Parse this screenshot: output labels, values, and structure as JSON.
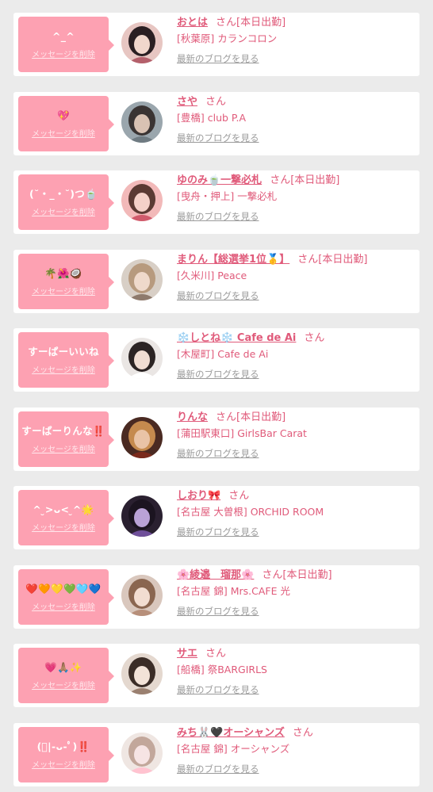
{
  "messages": [
    {
      "bubble_text": "^_^",
      "delete_label": "メッセージを削除",
      "name": "おとは",
      "honorific": "さん",
      "status": "[本日出勤]",
      "shop": "[秋葉原] カランコロン",
      "blog_link": "最新のブログを見る",
      "avatar_colors": [
        "#e7c6c2",
        "#2a1f22",
        "#f1d7cc",
        "#b4606b"
      ]
    },
    {
      "bubble_text": "💖",
      "delete_label": "メッセージを削除",
      "name": "さや",
      "honorific": "さん",
      "status": "",
      "shop": "[豊橋] club P.A",
      "blog_link": "最新のブログを見る",
      "avatar_colors": [
        "#9aa6ad",
        "#3a3433",
        "#d9c2b3",
        "#6f7b82"
      ]
    },
    {
      "bubble_text": "(˘・_・˘)つ🍵",
      "delete_label": "メッセージを削除",
      "name": "ゆのみ🍵一撃必札",
      "honorific": "さん",
      "status": "[本日出勤]",
      "shop": "[曳舟・押上] 一撃必札",
      "blog_link": "最新のブログを見る",
      "avatar_colors": [
        "#f2b9b9",
        "#5b3a33",
        "#f4d1c8",
        "#d05a6b"
      ]
    },
    {
      "bubble_text": "🌴🌺🥥",
      "delete_label": "メッセージを削除",
      "name": "まりん【総選挙1位🥇】",
      "honorific": "さん",
      "status": "[本日出勤]",
      "shop": "[久米川] Peace",
      "blog_link": "最新のブログを見る",
      "avatar_colors": [
        "#d8cfc6",
        "#b79a7e",
        "#efd9cb",
        "#8e7a6c"
      ]
    },
    {
      "bubble_text": "すーぱーいいね",
      "delete_label": "メッセージを削除",
      "name": "❄️しとね❄️ Cafe de Ai",
      "honorific": "さん",
      "status": "",
      "shop": "[木屋町] Cafe de Ai",
      "blog_link": "最新のブログを見る",
      "avatar_colors": [
        "#eae6e4",
        "#2b2424",
        "#f0ddd3",
        "#ffffff"
      ]
    },
    {
      "bubble_text": "すーぱーりんな‼️",
      "delete_label": "メッセージを削除",
      "name": "りんな",
      "honorific": "さん",
      "status": "[本日出勤]",
      "shop": "[蒲田駅東口] GirlsBar Carat",
      "blog_link": "最新のブログを見る",
      "avatar_colors": [
        "#4a2a22",
        "#c58a4e",
        "#e9c3a6",
        "#7a2a1c"
      ]
    },
    {
      "bubble_text": "^ ̮>ᴗ< ̮^🌟",
      "delete_label": "メッセージを削除",
      "name": "しおり🎀",
      "honorific": "さん",
      "status": "",
      "shop": "[名古屋 大曽根] ORCHID ROOM",
      "blog_link": "最新のブログを見る",
      "avatar_colors": [
        "#2a2030",
        "#1b1420",
        "#b9a2d6",
        "#6f4f9a"
      ]
    },
    {
      "bubble_text": "❤️🧡💛💚🩵💙",
      "delete_label": "メッセージを削除",
      "name": "🌸綾邉　瑠那🌸",
      "honorific": "さん",
      "status": "[本日出勤]",
      "shop": "[名古屋 錦] Mrs.CAFE 光",
      "blog_link": "最新のブログを見る",
      "avatar_colors": [
        "#d9c7bd",
        "#8a6650",
        "#f2ddd1",
        "#b78f7a"
      ]
    },
    {
      "bubble_text": "💗🙏🏽✨",
      "delete_label": "メッセージを削除",
      "name": "サエ",
      "honorific": "さん",
      "status": "",
      "shop": "[船橋] 祭BARGIRLS",
      "blog_link": "最新のブログを見る",
      "avatar_colors": [
        "#e4d8cf",
        "#3b2d27",
        "#f3e3d8",
        "#9a8070"
      ]
    },
    {
      "bubble_text": "(ﾟ|-ᴗ-ﾟ)‼️",
      "delete_label": "メッセージを削除",
      "name": "みち🐰🖤オーシャンズ",
      "honorific": "さん",
      "status": "",
      "shop": "[名古屋 錦] オーシャンズ",
      "blog_link": "最新のブログを見る",
      "avatar_colors": [
        "#efe6e2",
        "#c2a79b",
        "#f6e4e4",
        "#ffc3d0"
      ]
    }
  ]
}
